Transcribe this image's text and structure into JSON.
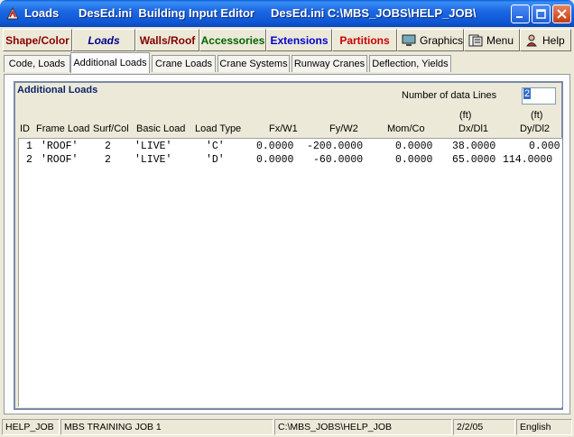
{
  "window": {
    "app_name": "Loads",
    "title": "DesEd.ini  Building Input Editor     DesEd.ini C:\\MBS_JOBS\\HELP_JOB\\"
  },
  "toolbar": {
    "buttons": [
      {
        "label": "Shape/Color",
        "color": "#8b0000"
      },
      {
        "label": "Loads",
        "color": "#00008b"
      },
      {
        "label": "Walls/Roof",
        "color": "#800000"
      },
      {
        "label": "Accessories",
        "color": "#006400"
      },
      {
        "label": "Extensions",
        "color": "#0000cd"
      },
      {
        "label": "Partitions",
        "color": "#cc0000"
      }
    ],
    "graphics_label": "Graphics",
    "menu_label": "Menu",
    "help_label": "Help"
  },
  "tabs": [
    {
      "label": "Code, Loads",
      "active": false
    },
    {
      "label": "Additional Loads",
      "active": true
    },
    {
      "label": "Crane Loads",
      "active": false
    },
    {
      "label": "Crane Systems",
      "active": false
    },
    {
      "label": "Runway Cranes",
      "active": false
    },
    {
      "label": "Deflection, Yields",
      "active": false
    }
  ],
  "panel": {
    "title": "Additional Loads",
    "num_lines_label": "Number of data Lines",
    "num_lines_value": "2",
    "units": {
      "dx": "(ft)",
      "dy": "(ft)"
    },
    "columns": [
      "ID",
      "Frame Load",
      "Surf/Col",
      "Basic Load",
      "Load Type",
      "Fx/W1",
      "Fy/W2",
      "Mom/Co",
      "Dx/Dl1",
      "Dy/Dl2"
    ],
    "rows": [
      {
        "id": "1",
        "frame_load": "'ROOF'",
        "surf_col": "2",
        "basic_load": "'LIVE'",
        "load_type": "'C'",
        "fx": "0.0000",
        "fy": "-200.0000",
        "mom": "0.0000",
        "dx": "38.0000",
        "dy": "0.000"
      },
      {
        "id": "2",
        "frame_load": "'ROOF'",
        "surf_col": "2",
        "basic_load": "'LIVE'",
        "load_type": "'D'",
        "fx": "0.0000",
        "fy": "-60.0000",
        "mom": "0.0000",
        "dx": "65.0000",
        "dy": "114.0000"
      }
    ]
  },
  "statusbar": {
    "job": "HELP_JOB",
    "description": "MBS TRAINING JOB 1",
    "path": "C:\\MBS_JOBS\\HELP_JOB",
    "date": "2/2/05",
    "language": "English"
  }
}
